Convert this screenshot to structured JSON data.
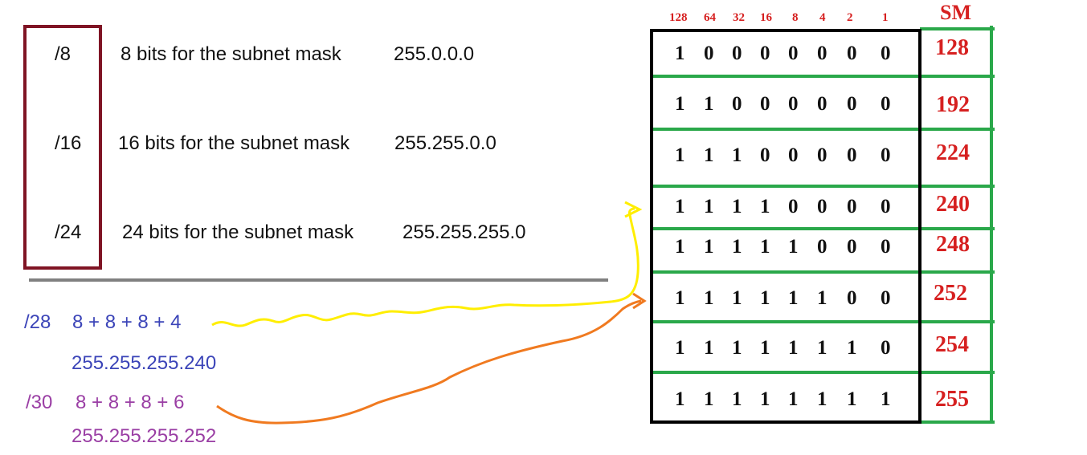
{
  "prefix_rows": [
    {
      "prefix": "/8",
      "description": "8 bits for the subnet mask",
      "mask": "255.0.0.0"
    },
    {
      "prefix": "/16",
      "description": "16 bits for the subnet mask",
      "mask": "255.255.0.0"
    },
    {
      "prefix": "/24",
      "description": "24 bits for the subnet mask",
      "mask": "255.255.255.0"
    }
  ],
  "examples": [
    {
      "prefix": "/28",
      "sum": "8 + 8 + 8 + 4",
      "mask": "255.255.255.240",
      "color": "#3b44b8"
    },
    {
      "prefix": "/30",
      "sum": "8 + 8 + 8 + 6",
      "mask": "255.255.255.252",
      "color": "#9a3ea4"
    }
  ],
  "table": {
    "bit_weights": [
      "128",
      "64",
      "32",
      "16",
      "8",
      "4",
      "2",
      "1"
    ],
    "sm_header": "SM",
    "rows": [
      {
        "bits": [
          "1",
          "0",
          "0",
          "0",
          "0",
          "0",
          "0",
          "0"
        ],
        "sm": "128"
      },
      {
        "bits": [
          "1",
          "1",
          "0",
          "0",
          "0",
          "0",
          "0",
          "0"
        ],
        "sm": "192"
      },
      {
        "bits": [
          "1",
          "1",
          "1",
          "0",
          "0",
          "0",
          "0",
          "0"
        ],
        "sm": "224"
      },
      {
        "bits": [
          "1",
          "1",
          "1",
          "1",
          "0",
          "0",
          "0",
          "0"
        ],
        "sm": "240"
      },
      {
        "bits": [
          "1",
          "1",
          "1",
          "1",
          "1",
          "0",
          "0",
          "0"
        ],
        "sm": "248"
      },
      {
        "bits": [
          "1",
          "1",
          "1",
          "1",
          "1",
          "1",
          "0",
          "0"
        ],
        "sm": "252"
      },
      {
        "bits": [
          "1",
          "1",
          "1",
          "1",
          "1",
          "1",
          "1",
          "0"
        ],
        "sm": "254"
      },
      {
        "bits": [
          "1",
          "1",
          "1",
          "1",
          "1",
          "1",
          "1",
          "1"
        ],
        "sm": "255"
      }
    ]
  },
  "colors": {
    "box_border": "#7f1424",
    "divider": "#808080",
    "table_border": "#000000",
    "grid_lines": "#2aa84a",
    "red_values": "#d62020",
    "arrow_yellow": "#ffee00",
    "arrow_orange": "#f07a20"
  }
}
